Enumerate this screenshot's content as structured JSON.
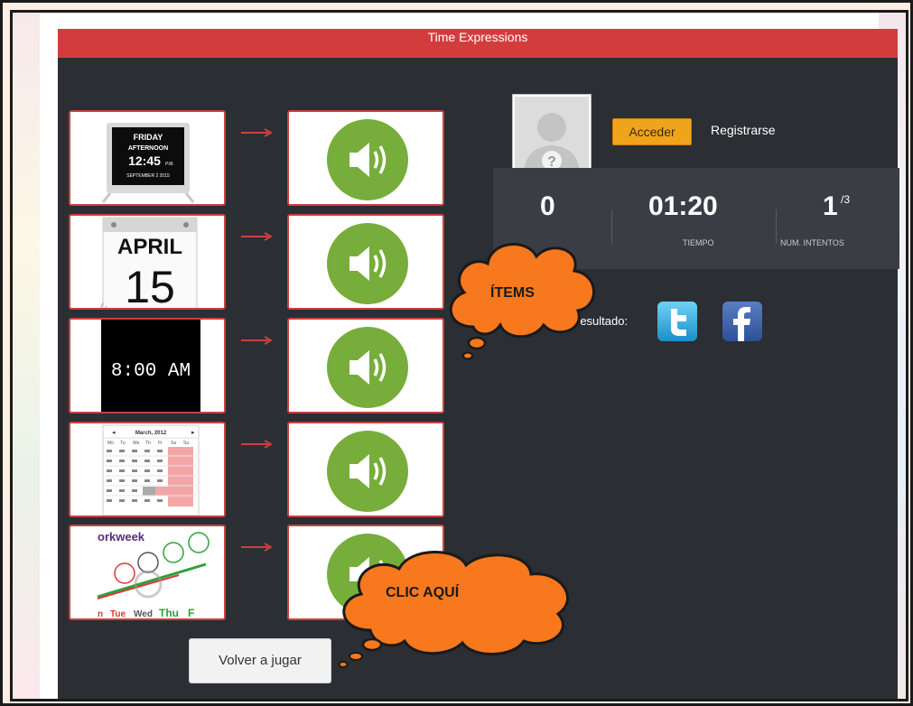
{
  "app": {
    "title": "Time Expressions",
    "accent_color": "#d33c3c",
    "speaker_color": "#77ad3a"
  },
  "items": [
    {
      "image": "digital-calendar-clock",
      "clock_day": "FRIDAY",
      "clock_period": "AFTERNOON",
      "clock_time": "12:45",
      "clock_ampm": "P.M.",
      "clock_date": "SEPTEMBER  2  2015"
    },
    {
      "image": "tear-off-calendar",
      "month": "APRIL",
      "day": "15"
    },
    {
      "image": "digital-clock",
      "time": "8:00 AM"
    },
    {
      "image": "month-calendar",
      "header": "March, 2012",
      "weekdays": [
        "Mo",
        "Tu",
        "We",
        "Th",
        "Fr",
        "Sa",
        "Su"
      ]
    },
    {
      "image": "workweek-chart",
      "caption": "orkweek",
      "days": [
        "n",
        "Tue",
        "Wed",
        "Thu",
        "F"
      ]
    }
  ],
  "auth": {
    "login_label": "Acceder",
    "register_label": "Registrarse"
  },
  "stats": {
    "score": "0",
    "time": "01:20",
    "time_label": "TIEMPO",
    "attempts": "1",
    "attempts_total": "/3",
    "attempts_label": "NUM. INTENTOS"
  },
  "share": {
    "label": "resultado:"
  },
  "replay_label": "Volver a jugar",
  "annotations": {
    "items_callout": "ÍTEMS",
    "click_callout": "CLIC AQUÍ",
    "callout_color": "#f7781d"
  }
}
